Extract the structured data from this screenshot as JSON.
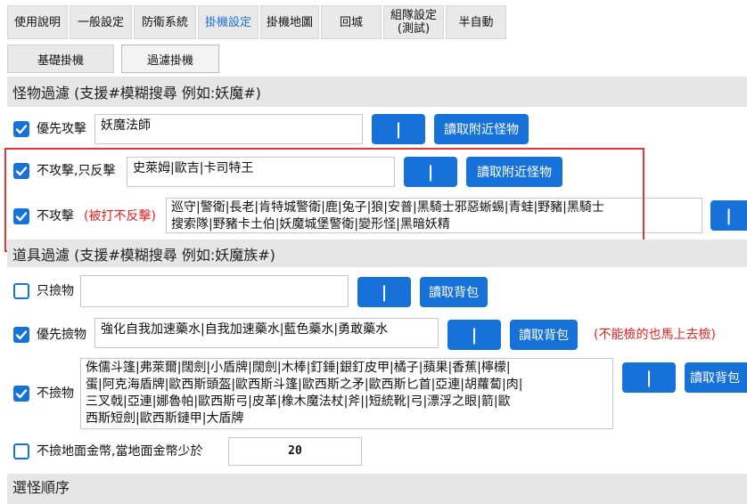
{
  "tabs": [
    {
      "label": "使用說明",
      "active": false
    },
    {
      "label": "一般設定",
      "active": false
    },
    {
      "label": "防衛系統",
      "active": false
    },
    {
      "label": "掛機設定",
      "active": true
    },
    {
      "label": "掛機地圖",
      "active": false
    },
    {
      "label": "回城",
      "active": false
    },
    {
      "label": "組隊設定\n(測試)",
      "active": false
    },
    {
      "label": "半自動",
      "active": false
    }
  ],
  "subtabs": [
    {
      "label": "基礎掛機",
      "active": false
    },
    {
      "label": "過濾掛機",
      "active": true
    }
  ],
  "monster_section": {
    "title": "怪物過濾 (支援#模糊搜尋 例如:妖魔#)"
  },
  "priority_attack": {
    "checked": true,
    "label": "優先攻擊",
    "value": "妖魔法師",
    "pipe": "|",
    "read_btn": "讀取附近怪物"
  },
  "no_attack_counter": {
    "checked": true,
    "label": "不攻擊,只反擊",
    "value": "史萊姆|歐吉|卡司特王",
    "pipe": "|",
    "read_btn": "讀取附近怪物"
  },
  "no_attack": {
    "checked": true,
    "label": "不攻擊",
    "note": "(被打不反擊)",
    "value_line1": "巡守|警衛|長老|肯特城警衛|鹿|兔子|狼|安普|黑騎士邪惡蜥蜴|青蛙|野豬|黑騎士",
    "value_line2": "搜索隊|野豬卡土伯|妖魔城堡警衛|變形怪|黑暗妖精",
    "pipe": "|"
  },
  "item_section": {
    "title": "道具過濾 (支援#模糊搜尋 例如:妖魔族#)"
  },
  "only_pick": {
    "checked": false,
    "label": "只撿物",
    "value": "",
    "pipe": "|",
    "read_btn": "讀取背包"
  },
  "priority_pick": {
    "checked": true,
    "label": "優先撿物",
    "value": "強化自我加速藥水|自我加速藥水|藍色藥水|勇敢藥水",
    "pipe": "|",
    "read_btn": "讀取背包",
    "note": "(不能檢的也馬上去檢)"
  },
  "no_pick": {
    "checked": true,
    "label": "不撿物",
    "lines": [
      "侏儒斗篷|弗萊爾|闊劍|小盾牌|闊劍|木棒|釘錘|銀釘皮甲|橘子|蘋果|香蕉|檸檬|",
      "蛋|阿克海盾牌|歐西斯頭盔|歐西斯斗篷|歐西斯之矛|歐西斯匕首|亞連|胡蘿蔔|肉|",
      "三叉戟|亞連|娜魯帕|歐西斯弓|皮革|橡木魔法杖|斧||短統靴|弓|漂浮之眼|箭|歐",
      "西斯短劍|歐西斯鏈甲|大盾牌"
    ],
    "pipe": "|",
    "read_btn": "讀取背包"
  },
  "gold_pick": {
    "checked": false,
    "label": "不撿地面金幣,當地面金幣少於",
    "value": "20"
  },
  "order_section": {
    "title": "選怪順序"
  },
  "colors": {
    "accent": "#1672d8",
    "warning": "#e52222",
    "highlight_box": "#e53636"
  }
}
